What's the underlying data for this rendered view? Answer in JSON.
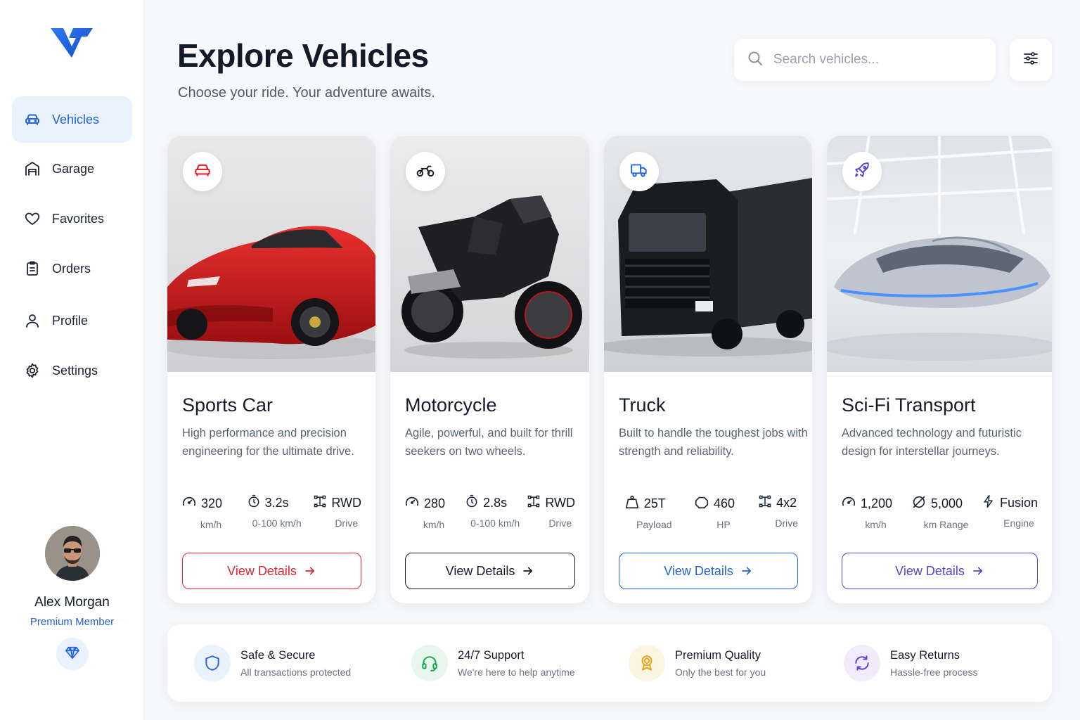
{
  "brand": {
    "accent": "#2563d9"
  },
  "sidebar": {
    "items": [
      {
        "label": "Vehicles",
        "icon": "car-icon",
        "active": true
      },
      {
        "label": "Garage",
        "icon": "garage-icon"
      },
      {
        "label": "Favorites",
        "icon": "heart-icon"
      },
      {
        "label": "Orders",
        "icon": "clipboard-icon"
      },
      {
        "label": "Profile",
        "icon": "user-icon"
      },
      {
        "label": "Settings",
        "icon": "gear-icon"
      }
    ],
    "user": {
      "name": "Alex Morgan",
      "tier": "Premium Member",
      "badge_icon": "diamond-icon"
    }
  },
  "header": {
    "title": "Explore Vehicles",
    "subtitle": "Choose your ride. Your adventure awaits.",
    "search_placeholder": "Search vehicles...",
    "filter_icon": "sliders-icon"
  },
  "cards": [
    {
      "title": "Sports Car",
      "description": "High performance and precision engineering for the ultimate drive.",
      "badge_icon": "car-icon",
      "accent": "#e0242c",
      "specs": [
        {
          "icon": "speedometer-icon",
          "value": "320",
          "label": "km/h"
        },
        {
          "icon": "stopwatch-icon",
          "value": "3.2s",
          "label": "0-100 km/h"
        },
        {
          "icon": "drivetrain-icon",
          "value": "RWD",
          "label": "Drive"
        }
      ],
      "button": "View Details"
    },
    {
      "title": "Motorcycle",
      "description": "Agile, powerful, and built for thrill seekers on two wheels.",
      "badge_icon": "motorcycle-icon",
      "accent": "#141b29",
      "specs": [
        {
          "icon": "speedometer-icon",
          "value": "280",
          "label": "km/h"
        },
        {
          "icon": "stopwatch-icon",
          "value": "2.8s",
          "label": "0-100 km/h"
        },
        {
          "icon": "drivetrain-icon",
          "value": "RWD",
          "label": "Drive"
        }
      ],
      "button": "View Details"
    },
    {
      "title": "Truck",
      "description": "Built to handle the toughest jobs with strength and reliability.",
      "badge_icon": "truck-icon",
      "accent": "#2563d9",
      "specs": [
        {
          "icon": "weight-icon",
          "value": "25T",
          "label": "Payload"
        },
        {
          "icon": "engine-icon",
          "value": "460",
          "label": "HP"
        },
        {
          "icon": "drivetrain-icon",
          "value": "4x2",
          "label": "Drive"
        }
      ],
      "button": "View Details"
    },
    {
      "title": "Sci-Fi Transport",
      "description": "Advanced technology and futuristic design for interstellar journeys.",
      "badge_icon": "rocket-icon",
      "accent": "#5b3fd6",
      "specs": [
        {
          "icon": "speedometer-icon",
          "value": "1,200",
          "label": "km/h"
        },
        {
          "icon": "range-icon",
          "value": "5,000",
          "label": "km Range"
        },
        {
          "icon": "bolt-icon",
          "value": "Fusion",
          "label": "Engine"
        }
      ],
      "button": "View Details"
    }
  ],
  "features": [
    {
      "title": "Safe & Secure",
      "subtitle": "All transactions protected",
      "icon": "shield-icon",
      "color": "#2563d9"
    },
    {
      "title": "24/7 Support",
      "subtitle": "We're here to help anytime",
      "icon": "headset-icon",
      "color": "#16a34a"
    },
    {
      "title": "Premium Quality",
      "subtitle": "Only the best for you",
      "icon": "award-icon",
      "color": "#e8a317"
    },
    {
      "title": "Easy Returns",
      "subtitle": "Hassle-free process",
      "icon": "refresh-icon",
      "color": "#5b3fd6"
    }
  ]
}
